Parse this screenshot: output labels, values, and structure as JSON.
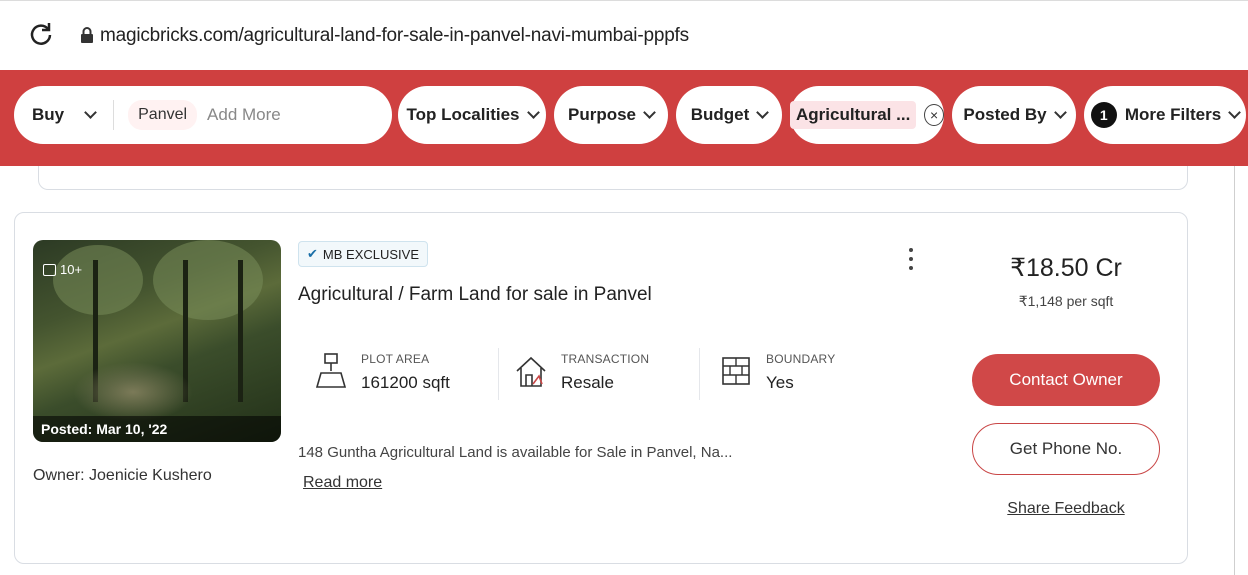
{
  "browser": {
    "url": "magicbricks.com/agricultural-land-for-sale-in-panvel-navi-mumbai-pppfs"
  },
  "filters": {
    "buy_label": "Buy",
    "location_tag": "Panvel",
    "add_more_label": "Add More",
    "top_localities": "Top Localities",
    "purpose": "Purpose",
    "budget": "Budget",
    "agricultural": "Agricultural ...",
    "posted_by": "Posted By",
    "more_filters_count": "1",
    "more_filters": "More Filters",
    "accent_color": "#cf4040"
  },
  "listing": {
    "image_count": "10+",
    "posted": "Posted: Mar 10, '22",
    "owner": "Owner: Joenicie Kushero",
    "badge": "MB EXCLUSIVE",
    "title": "Agricultural / Farm Land for sale in Panvel",
    "specs": [
      {
        "label": "PLOT AREA",
        "value": "161200 sqft",
        "icon": "plot-area-icon"
      },
      {
        "label": "TRANSACTION",
        "value": "Resale",
        "icon": "house-icon"
      },
      {
        "label": "BOUNDARY",
        "value": "Yes",
        "icon": "wall-icon"
      }
    ],
    "description": "148 Guntha Agricultural Land is available for Sale in Panvel, Na...",
    "read_more": "Read more",
    "price": "₹18.50 Cr",
    "price_per_sqft": "₹1,148 per sqft",
    "contact_owner": "Contact Owner",
    "get_phone": "Get Phone No.",
    "share_feedback": "Share Feedback"
  }
}
